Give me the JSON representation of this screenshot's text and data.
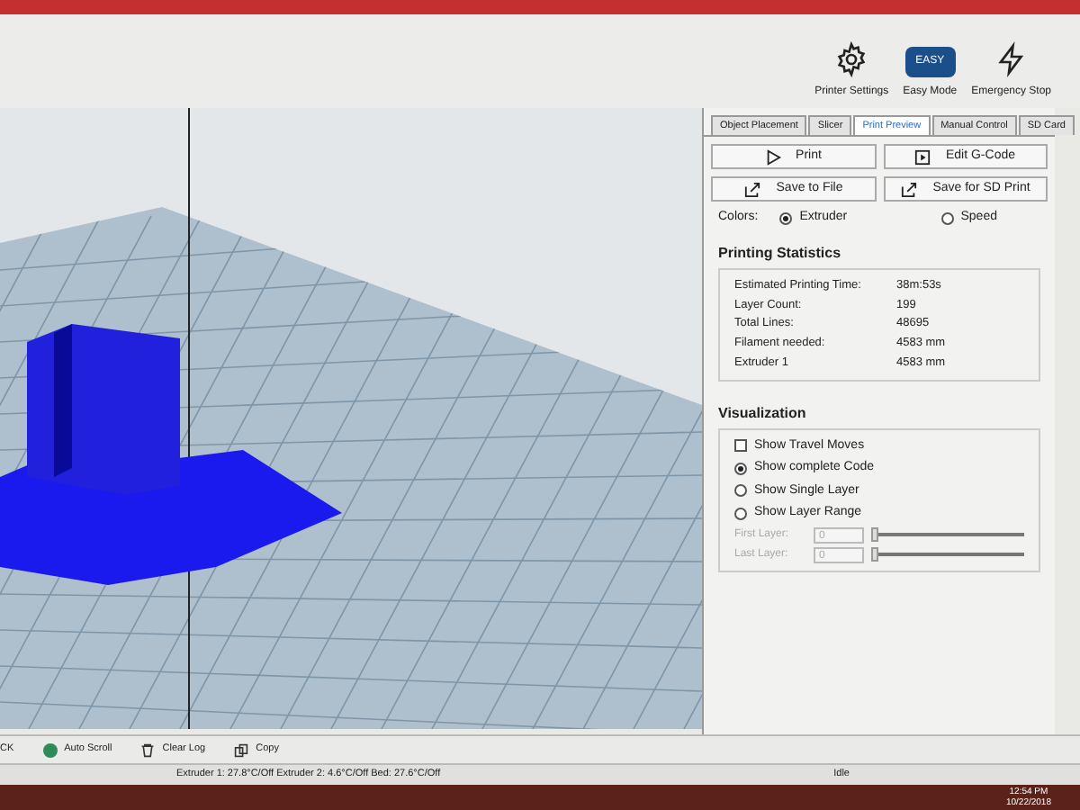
{
  "toolbar": {
    "buttons": [
      {
        "kind": "gear",
        "label": "Printer Settings"
      },
      {
        "kind": "easy",
        "label": "Easy Mode",
        "badge": "EASY"
      },
      {
        "kind": "bolt",
        "label": "Emergency Stop"
      }
    ]
  },
  "tabs": [
    {
      "label": "Object Placement",
      "selected": false
    },
    {
      "label": "Slicer",
      "selected": false
    },
    {
      "label": "Print Preview",
      "selected": true
    },
    {
      "label": "Manual Control",
      "selected": false
    },
    {
      "label": "SD Card",
      "selected": false
    }
  ],
  "actions": [
    {
      "kind": "play",
      "label": "Print"
    },
    {
      "kind": "edit",
      "label": "Edit G-Code"
    },
    {
      "kind": "export",
      "label": "Save to File"
    },
    {
      "kind": "export",
      "label": "Save for SD Print"
    }
  ],
  "colors": {
    "label": "Colors:",
    "options": [
      {
        "label": "Extruder",
        "selected": true
      },
      {
        "label": "Speed",
        "selected": false
      }
    ]
  },
  "statistics": {
    "title": "Printing Statistics",
    "rows": [
      {
        "label": "Estimated Printing Time:",
        "value": "38m:53s"
      },
      {
        "label": "Layer Count:",
        "value": "199"
      },
      {
        "label": "Total Lines:",
        "value": "48695"
      },
      {
        "label": "Filament needed:",
        "value": "4583 mm"
      },
      {
        "label": "Extruder 1",
        "value": "4583 mm"
      }
    ]
  },
  "visualization": {
    "title": "Visualization",
    "options": [
      {
        "kind": "checkbox",
        "label": "Show Travel Moves",
        "checked": false
      },
      {
        "kind": "radio",
        "label": "Show complete Code",
        "selected": true
      },
      {
        "kind": "radio",
        "label": "Show Single Layer",
        "selected": false
      },
      {
        "kind": "radio",
        "label": "Show Layer Range",
        "selected": false
      }
    ],
    "layers": [
      {
        "label": "First Layer:",
        "value": "0",
        "level": 0,
        "disabled": true
      },
      {
        "label": "Last Layer:",
        "value": "0",
        "level": 0,
        "disabled": true
      }
    ]
  },
  "log_bar": {
    "items": [
      {
        "kind": "text",
        "label": "CK"
      },
      {
        "kind": "dot",
        "label": "Auto Scroll"
      },
      {
        "kind": "trash",
        "label": "Clear Log"
      },
      {
        "kind": "copy",
        "label": "Copy"
      }
    ]
  },
  "status_bar": {
    "temperatures": "Extruder 1: 27.8°C/Off Extruder 2: 4.6°C/Off Bed: 27.6°C/Off",
    "state": "Idle"
  },
  "taskbar": {
    "time": "12:54 PM",
    "date": "10/22/2018"
  }
}
